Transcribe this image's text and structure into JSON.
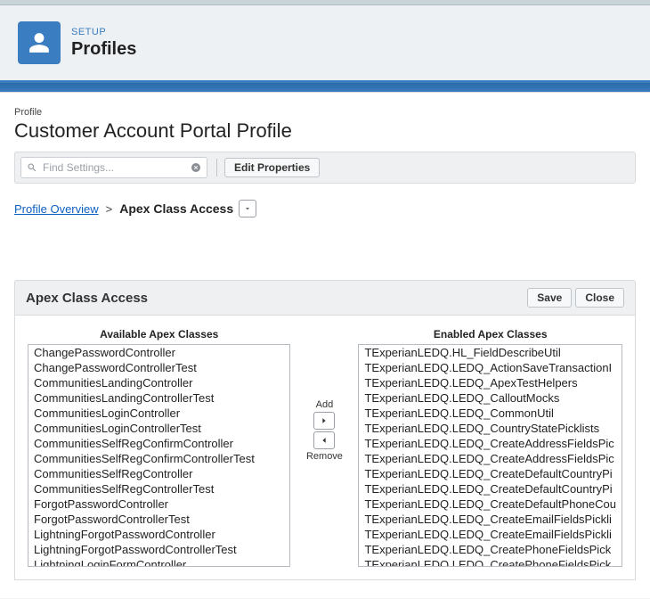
{
  "header": {
    "eyebrow": "SETUP",
    "title": "Profiles"
  },
  "page": {
    "eyebrow": "Profile",
    "title": "Customer Account Portal Profile"
  },
  "toolbar": {
    "search_placeholder": "Find Settings...",
    "edit_label": "Edit Properties"
  },
  "breadcrumb": {
    "overview": "Profile Overview",
    "sep": ">",
    "current": "Apex Class Access"
  },
  "section": {
    "title": "Apex Class Access",
    "save_label": "Save",
    "close_label": "Close"
  },
  "dual": {
    "available_heading": "Available Apex Classes",
    "enabled_heading": "Enabled Apex Classes",
    "add_label": "Add",
    "remove_label": "Remove",
    "available": [
      "ChangePasswordController",
      "ChangePasswordControllerTest",
      "CommunitiesLandingController",
      "CommunitiesLandingControllerTest",
      "CommunitiesLoginController",
      "CommunitiesLoginControllerTest",
      "CommunitiesSelfRegConfirmController",
      "CommunitiesSelfRegConfirmControllerTest",
      "CommunitiesSelfRegController",
      "CommunitiesSelfRegControllerTest",
      "ForgotPasswordController",
      "ForgotPasswordControllerTest",
      "LightningForgotPasswordController",
      "LightningForgotPasswordControllerTest",
      "LightningLoginFormController"
    ],
    "enabled": [
      "TExperianLEDQ.HL_FieldDescribeUtil",
      "TExperianLEDQ.LEDQ_ActionSaveTransactionI",
      "TExperianLEDQ.LEDQ_ApexTestHelpers",
      "TExperianLEDQ.LEDQ_CalloutMocks",
      "TExperianLEDQ.LEDQ_CommonUtil",
      "TExperianLEDQ.LEDQ_CountryStatePicklists",
      "TExperianLEDQ.LEDQ_CreateAddressFieldsPic",
      "TExperianLEDQ.LEDQ_CreateAddressFieldsPic",
      "TExperianLEDQ.LEDQ_CreateDefaultCountryPi",
      "TExperianLEDQ.LEDQ_CreateDefaultCountryPi",
      "TExperianLEDQ.LEDQ_CreateDefaultPhoneCou",
      "TExperianLEDQ.LEDQ_CreateEmailFieldsPickli",
      "TExperianLEDQ.LEDQ_CreateEmailFieldsPickli",
      "TExperianLEDQ.LEDQ_CreatePhoneFieldsPick",
      "TExperianLEDQ.LEDQ_CreatePhoneFieldsPick"
    ]
  }
}
